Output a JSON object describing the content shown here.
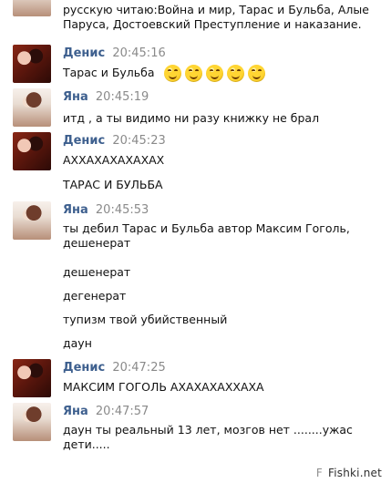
{
  "messages": [
    {
      "sender": "",
      "time": "",
      "avatar": "yana-avatar",
      "lines": [
        "русскую читаю:Война и мир, Тарас и Бульба, Алые Паруса, Достоевский Преступление и наказание."
      ]
    },
    {
      "sender": "Денис",
      "time": "20:45:16",
      "avatar": "denis-avatar",
      "lines": [
        "Тарас и Бульба"
      ],
      "emoji_count": 5
    },
    {
      "sender": "Яна",
      "time": "20:45:19",
      "avatar": "yana-avatar",
      "lines": [
        "итд , а ты видимо ни разу книжку не брал"
      ]
    },
    {
      "sender": "Денис",
      "time": "20:45:23",
      "avatar": "denis-avatar",
      "lines": [
        "АХХАХАХАХАХАХ",
        "ТАРАС И БУЛЬБА"
      ]
    },
    {
      "sender": "Яна",
      "time": "20:45:53",
      "avatar": "yana-avatar",
      "lines": [
        "ты дебил Тарас и Бульба автор Максим Гоголь, дешенерат",
        "дешенерат",
        "дегенерат",
        "тупизм твой убийственный",
        "даун"
      ]
    },
    {
      "sender": "Денис",
      "time": "20:47:25",
      "avatar": "denis-avatar",
      "lines": [
        "МАКСИМ ГОГОЛЬ АХАХАХАХХАХА"
      ]
    },
    {
      "sender": "Яна",
      "time": "20:47:57",
      "avatar": "yana-avatar",
      "lines": [
        "даун ты реальный 13 лет, мозгов нет ........ужас дети....."
      ]
    }
  ],
  "watermark": {
    "prefix": "F",
    "main": "Fishki.net"
  }
}
